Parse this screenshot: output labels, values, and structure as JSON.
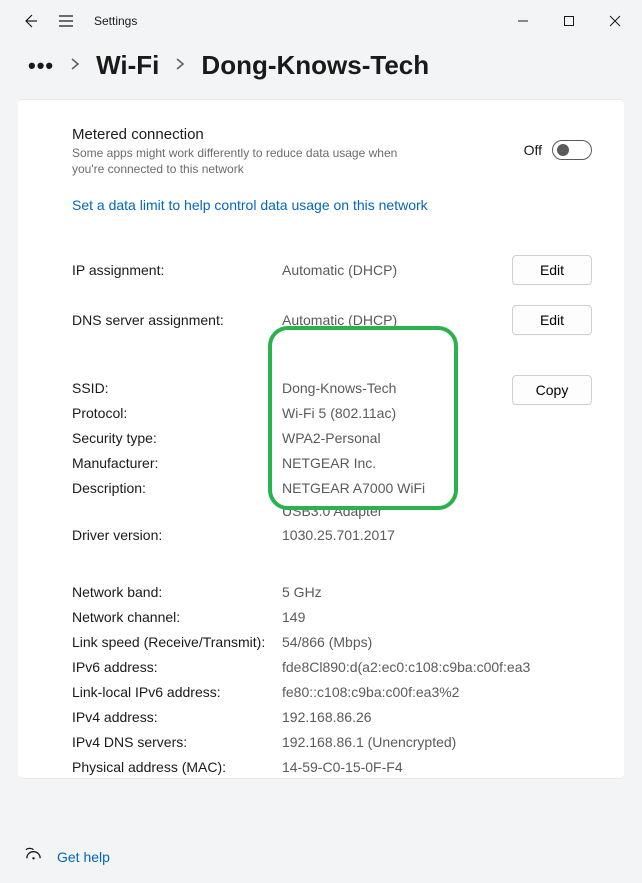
{
  "titlebar": {
    "title": "Settings"
  },
  "breadcrumb": {
    "truncate": "•••",
    "wifi": "Wi-Fi",
    "network": "Dong-Knows-Tech"
  },
  "metered": {
    "title": "Metered connection",
    "subtitle": "Some apps might work differently to reduce data usage when you're connected to this network",
    "toggle_label": "Off",
    "link": "Set a data limit to help control data usage on this network"
  },
  "assignment": {
    "ip_label": "IP assignment:",
    "ip_value": "Automatic (DHCP)",
    "dns_label": "DNS server assignment:",
    "dns_value": "Automatic (DHCP)",
    "edit": "Edit"
  },
  "details_main": [
    {
      "k": "SSID:",
      "v": "Dong-Knows-Tech"
    },
    {
      "k": "Protocol:",
      "v": "Wi-Fi 5 (802.11ac)"
    },
    {
      "k": "Security type:",
      "v": "WPA2-Personal"
    },
    {
      "k": "Manufacturer:",
      "v": "NETGEAR Inc."
    },
    {
      "k": "Description:",
      "v": "NETGEAR A7000 WiFi USB3.0 Adapter",
      "multi": true
    },
    {
      "k": "Driver version:",
      "v": "1030.25.701.2017"
    }
  ],
  "copy": "Copy",
  "details_extra": [
    {
      "k": "Network band:",
      "v": "5 GHz"
    },
    {
      "k": "Network channel:",
      "v": "149"
    },
    {
      "k": "Link speed (Receive/Transmit):",
      "v": "54/866 (Mbps)"
    },
    {
      "k": "IPv6 address:",
      "v": "fde8Cl890:d(a2:ec0:c108:c9ba:c00f:ea3",
      "multi": true
    },
    {
      "k": "Link-local IPv6 address:",
      "v": "fe80::c108:c9ba:c00f:ea3%2"
    },
    {
      "k": "IPv4 address:",
      "v": "192.168.86.26"
    },
    {
      "k": "IPv4 DNS servers:",
      "v": "192.168.86.1 (Unencrypted)"
    },
    {
      "k": "Physical address (MAC):",
      "v": "14-59-C0-15-0F-F4"
    }
  ],
  "footer": {
    "help": "Get help"
  }
}
